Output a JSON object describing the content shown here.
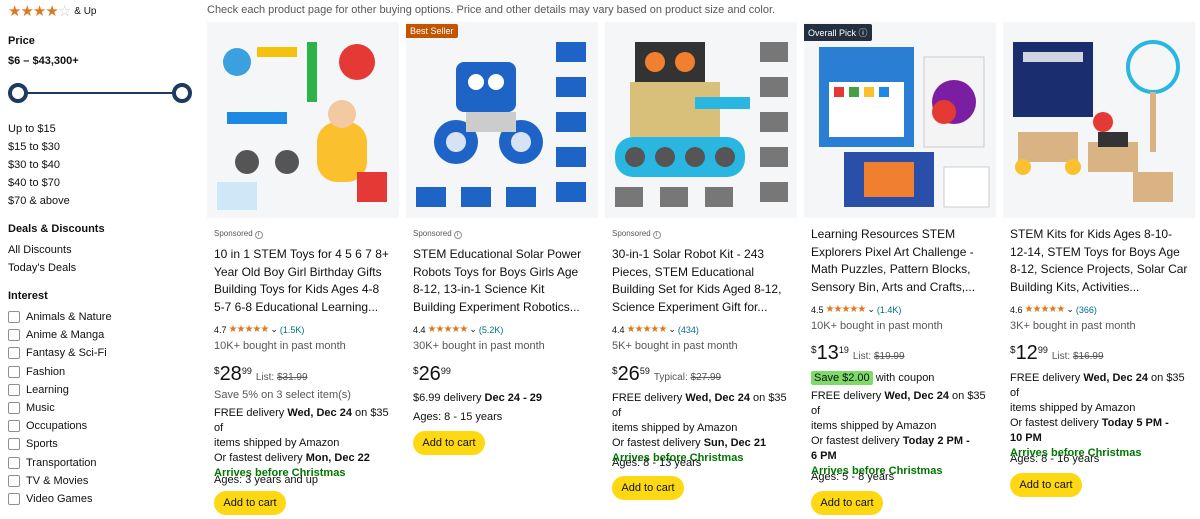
{
  "sidebar": {
    "review_filter": {
      "stars": 4,
      "label": "& Up"
    },
    "price": {
      "title": "Price",
      "range": "$6 – $43,300+",
      "slider": {
        "min_fraction": 0,
        "max_fraction": 1
      },
      "links": [
        "Up to $15",
        "$15 to $30",
        "$30 to $40",
        "$40 to $70",
        "$70 & above"
      ]
    },
    "deals": {
      "title": "Deals & Discounts",
      "links": [
        "All Discounts",
        "Today's Deals"
      ]
    },
    "interest": {
      "title": "Interest",
      "items": [
        "Animals & Nature",
        "Anime & Manga",
        "Fantasy & Sci-Fi",
        "Fashion",
        "Learning",
        "Music",
        "Occupations",
        "Sports",
        "Transportation",
        "TV & Movies",
        "Video Games"
      ]
    }
  },
  "top_note": "Check each product page for other buying options. Price and other details may vary based on product size and color.",
  "products": [
    {
      "badge": "",
      "sponsored": "Sponsored",
      "title_l1": "10 in 1 STEM Toys for 4 5 6 7 8+",
      "title_l2": "Year Old Boy Girl Birthday Gifts",
      "title_l3": "Building Toys for Kids Ages 4-8",
      "title_l4": "5-7 6-8 Educational Learning...",
      "rating": "4.7",
      "stars": 4.5,
      "reviews": "(1.5K)",
      "bought": "10K+ bought in past month",
      "price_whole": "28",
      "price_frac": "99",
      "list_label": "List:",
      "list_price": "$31.99",
      "save_note": "Save 5% on 3 select item(s)",
      "delivery_a": "FREE delivery ",
      "delivery_date": "Wed, Dec 24",
      "delivery_b": " on $35 of",
      "delivery_c": "items shipped by Amazon",
      "fastest_a": "Or fastest delivery ",
      "fastest_date": "Mon, Dec 22",
      "christmas": "Arrives before Christmas",
      "ages": "Ages: 3 years and up",
      "button": "Add to cart"
    },
    {
      "badge": "Best Seller",
      "sponsored": "Sponsored",
      "title_l1": "STEM Educational Solar Power",
      "title_l2": "Robots Toys for Boys Girls Age",
      "title_l3": "8-12, 13-in-1 Science Kit",
      "title_l4": "Building Experiment Robotics...",
      "rating": "4.4",
      "stars": 4.5,
      "reviews": "(5.2K)",
      "bought": "30K+ bought in past month",
      "price_whole": "26",
      "price_frac": "99",
      "delivery_a": "$6.99 delivery ",
      "delivery_date": "Dec 24 - 29",
      "ages": "Ages: 8 - 15 years",
      "button": "Add to cart"
    },
    {
      "badge": "",
      "sponsored": "Sponsored",
      "title_l1": "30-in-1 Solar Robot Kit - 243",
      "title_l2": "Pieces, STEM Educational",
      "title_l3": "Building Set for Kids Aged 8-12,",
      "title_l4": "Science Experiment Gift for...",
      "rating": "4.4",
      "stars": 4.5,
      "reviews": "(434)",
      "bought": "5K+ bought in past month",
      "price_whole": "26",
      "price_frac": "59",
      "list_label": "Typical:",
      "list_price": "$27.99",
      "delivery_a": "FREE delivery ",
      "delivery_date": "Wed, Dec 24",
      "delivery_b": " on $35 of",
      "delivery_c": "items shipped by Amazon",
      "fastest_a": "Or fastest delivery ",
      "fastest_date": "Sun, Dec 21",
      "christmas": "Arrives before Christmas",
      "ages": "Ages: 8 - 13 years",
      "button": "Add to cart"
    },
    {
      "badge": "Overall Pick",
      "sponsored": "",
      "title_l1": "Learning Resources STEM",
      "title_l2": "Explorers Pixel Art Challenge -",
      "title_l3": "Math Puzzles, Pattern Blocks,",
      "title_l4": "Sensory Bin, Arts and Crafts,...",
      "rating": "4.5",
      "stars": 4.5,
      "reviews": "(1.4K)",
      "bought": "10K+ bought in past month",
      "price_whole": "13",
      "price_frac": "19",
      "list_label": "List:",
      "list_price": "$19.99",
      "coupon_badge": "Save $2.00",
      "coupon_text": "with coupon",
      "delivery_a": "FREE delivery ",
      "delivery_date": "Wed, Dec 24",
      "delivery_b": " on $35 of",
      "delivery_c": "items shipped by Amazon",
      "fastest_a": "Or fastest delivery ",
      "fastest_date": "Today 2 PM -",
      "fastest_date2": "6 PM",
      "christmas": "Arrives before Christmas",
      "ages": "Ages: 5 - 8 years",
      "button": "Add to cart"
    },
    {
      "badge": "",
      "sponsored": "",
      "title_l1": "STEM Kits for Kids Ages 8-10-",
      "title_l2": "12-14, STEM Toys for Boys Age",
      "title_l3": "8-12, Science Projects, Solar Car",
      "title_l4": "Building Kits, Activities...",
      "rating": "4.6",
      "stars": 4.5,
      "reviews": "(366)",
      "bought": "3K+ bought in past month",
      "price_whole": "12",
      "price_frac": "99",
      "list_label": "List:",
      "list_price": "$16.99",
      "delivery_a": "FREE delivery ",
      "delivery_date": "Wed, Dec 24",
      "delivery_b": " on $35 of",
      "delivery_c": "items shipped by Amazon",
      "fastest_a": "Or fastest delivery ",
      "fastest_date": "Today 5 PM -",
      "fastest_date2": "10 PM",
      "christmas": "Arrives before Christmas",
      "ages": "Ages: 8 - 16 years",
      "button": "Add to cart"
    }
  ],
  "colors": {
    "star": "#de7921",
    "link": "#007185",
    "green": "#007600",
    "button": "#ffd814",
    "best_seller": "#c45500",
    "overall_pick": "#232f3e",
    "slider": "#1e3a5f"
  },
  "image_icons": [
    "stem-building-toy-image",
    "solar-robot-toy-image",
    "solar-robot-kit-image",
    "pixel-art-kit-image",
    "stem-kits-image"
  ]
}
